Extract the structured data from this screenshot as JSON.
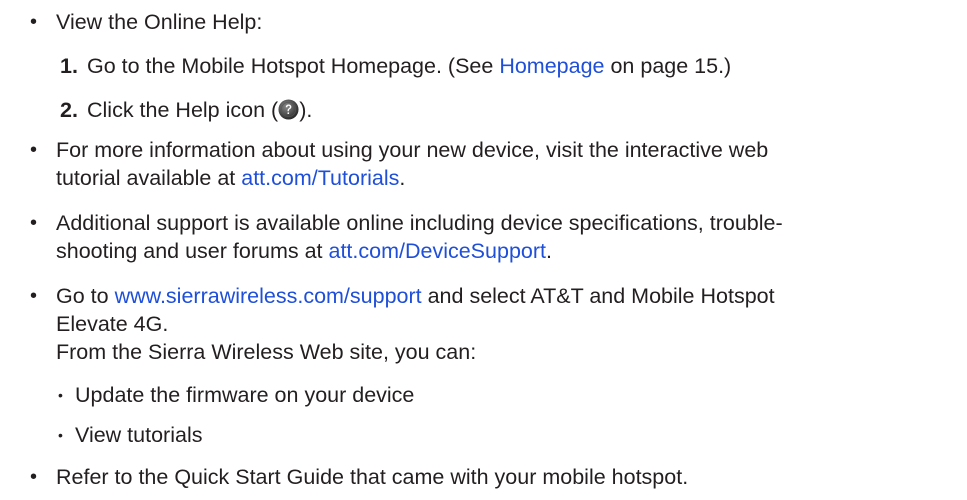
{
  "bullets": {
    "view_help": "View the Online Help:",
    "steps": {
      "step1": {
        "number": "1.",
        "text_before": "Go to the Mobile Hotspot Homepage. (See ",
        "link": "Homepage",
        "text_after": " on page 15.)"
      },
      "step2": {
        "number": "2.",
        "text_before": "Click the Help icon (",
        "text_after": ")."
      }
    },
    "tutorial": {
      "line1": "For more information about using your new device, visit the interactive web",
      "line2_before": "tutorial available at ",
      "line2_link": "att.com/Tutorials",
      "line2_after": "."
    },
    "support": {
      "line1": "Additional support is available online including device specifications, trouble-",
      "line2_before": "shooting and user forums at ",
      "line2_link": "att.com/DeviceSupport",
      "line2_after": "."
    },
    "sierra": {
      "line1_before": "Go to ",
      "line1_link": "www.sierrawireless.com/support",
      "line1_after": " and select AT&T and Mobile Hotspot",
      "line2": "Elevate 4G.",
      "line3": "From the Sierra Wireless Web site, you can:",
      "sub_items": [
        "Update the firmware on your device",
        "View tutorials"
      ]
    },
    "quick_start": "Refer to the Quick Start Guide that came with your mobile hotspot."
  },
  "icons": {
    "bullet": "bullet-dot",
    "sub_bullet": "small-dot",
    "help": "help-icon"
  },
  "colors": {
    "text": "#231f20",
    "link": "#1f4fd8"
  }
}
